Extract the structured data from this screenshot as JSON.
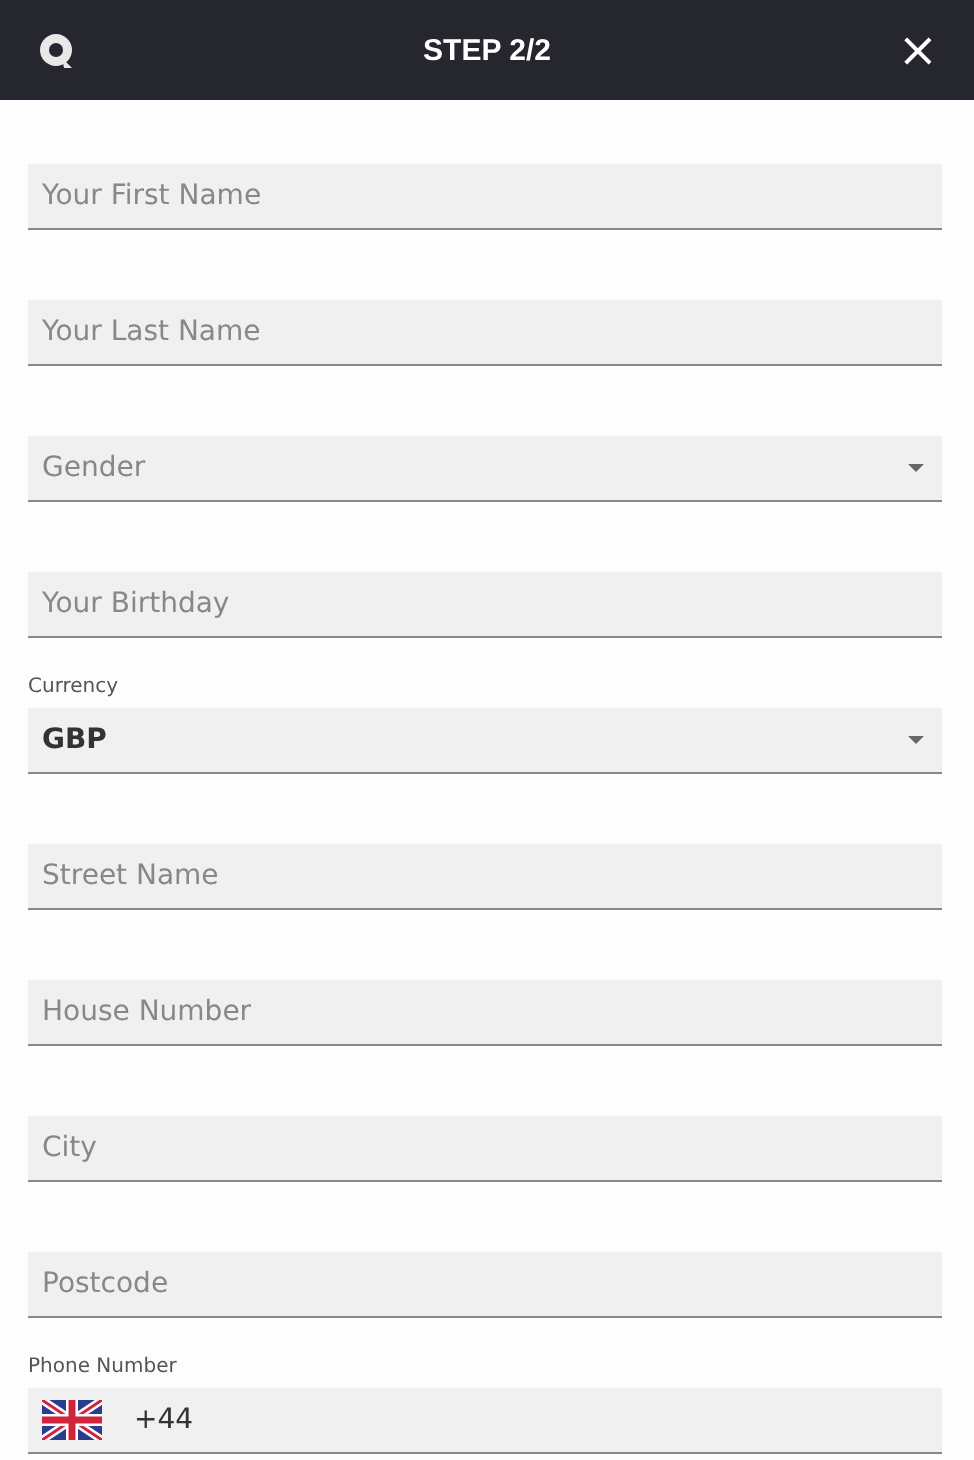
{
  "header": {
    "title": "STEP 2/2",
    "close": "×"
  },
  "fields": [
    {
      "kind": "text",
      "placeholder": "Your First Name"
    },
    {
      "kind": "text",
      "placeholder": "Your Last Name"
    },
    {
      "kind": "select",
      "placeholder": "Gender"
    },
    {
      "kind": "text",
      "placeholder": "Your Birthday"
    },
    {
      "kind": "select",
      "label": "Currency",
      "value": "GBP"
    },
    {
      "kind": "text",
      "placeholder": "Street Name"
    },
    {
      "kind": "text",
      "placeholder": "House Number"
    },
    {
      "kind": "text",
      "placeholder": "City"
    },
    {
      "kind": "text",
      "placeholder": "Postcode"
    },
    {
      "kind": "phone",
      "label": "Phone Number",
      "value": "+44"
    }
  ]
}
